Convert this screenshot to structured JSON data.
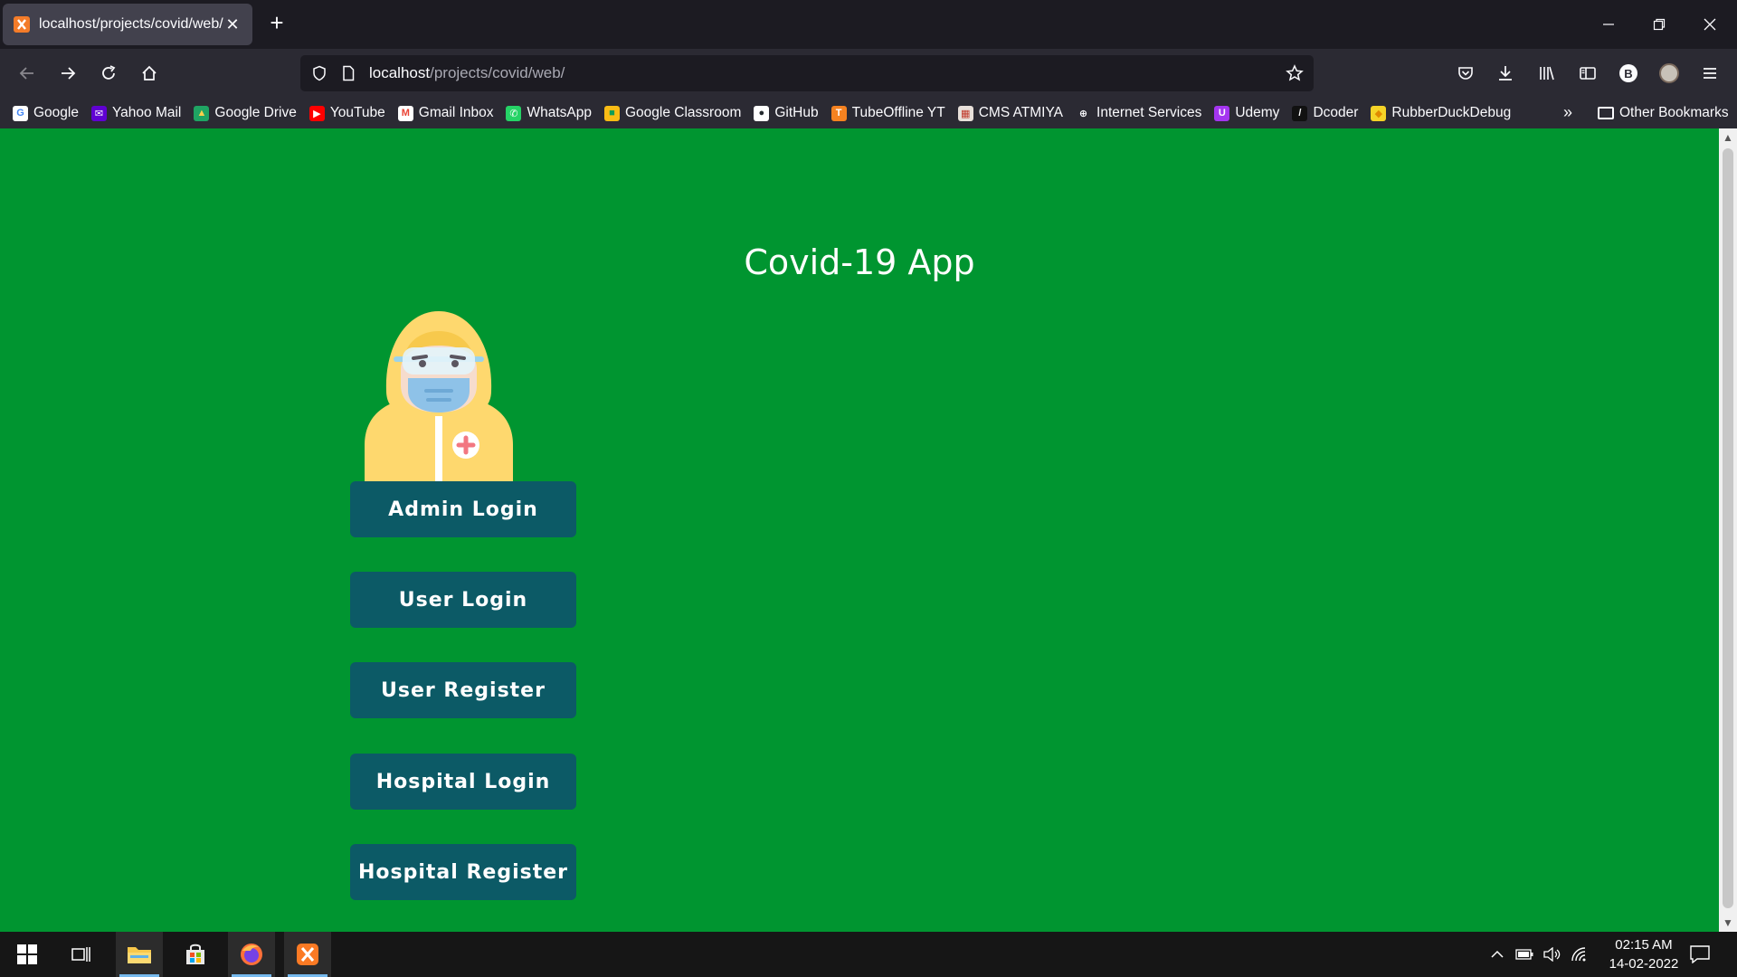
{
  "browser": {
    "tab": {
      "title": "localhost/projects/covid/web/",
      "close_glyph": "✕"
    },
    "new_tab_glyph": "+",
    "url": {
      "host": "localhost",
      "path": "/projects/covid/web/"
    },
    "profile_initial": "B"
  },
  "bookmarks": [
    {
      "label": "Google",
      "icon": "google-icon",
      "color": "#ffffff",
      "glyph": "G",
      "glyph_color": "#4285f4"
    },
    {
      "label": "Yahoo Mail",
      "icon": "yahoo-mail-icon",
      "color": "#6001d2",
      "glyph": "✉",
      "glyph_color": "#ffffff"
    },
    {
      "label": "Google Drive",
      "icon": "google-drive-icon",
      "color": "#1fa463",
      "glyph": "▲",
      "glyph_color": "#ffd04b"
    },
    {
      "label": "YouTube",
      "icon": "youtube-icon",
      "color": "#ff0000",
      "glyph": "▶",
      "glyph_color": "#ffffff"
    },
    {
      "label": "Gmail Inbox",
      "icon": "gmail-icon",
      "color": "#ffffff",
      "glyph": "M",
      "glyph_color": "#ea4335"
    },
    {
      "label": "WhatsApp",
      "icon": "whatsapp-icon",
      "color": "#25d366",
      "glyph": "✆",
      "glyph_color": "#ffffff"
    },
    {
      "label": "Google Classroom",
      "icon": "google-classroom-icon",
      "color": "#f9bc15",
      "glyph": "■",
      "glyph_color": "#0f9d58"
    },
    {
      "label": "GitHub",
      "icon": "github-icon",
      "color": "#ffffff",
      "glyph": "●",
      "glyph_color": "#24292e"
    },
    {
      "label": "TubeOffline YT",
      "icon": "tubeoffline-icon",
      "color": "#f58220",
      "glyph": "T",
      "glyph_color": "#ffffff"
    },
    {
      "label": "CMS ATMIYA",
      "icon": "cms-atmiya-icon",
      "color": "#e8e0da",
      "glyph": "▦",
      "glyph_color": "#c0392b"
    },
    {
      "label": "Internet Services",
      "icon": "globe-icon",
      "color": "#2b2a33",
      "glyph": "⊕",
      "glyph_color": "#fbfbfe"
    },
    {
      "label": "Udemy",
      "icon": "udemy-icon",
      "color": "#a435f0",
      "glyph": "U",
      "glyph_color": "#ffffff"
    },
    {
      "label": "Dcoder",
      "icon": "dcoder-icon",
      "color": "#111111",
      "glyph": "/",
      "glyph_color": "#ffffff"
    },
    {
      "label": "RubberDuckDebug",
      "icon": "rubber-duck-icon",
      "color": "#f5d327",
      "glyph": "◆",
      "glyph_color": "#e08a00"
    }
  ],
  "bookmarks_more_glyph": "»",
  "other_bookmarks": "Other Bookmarks",
  "page": {
    "title": "Covid-19 App",
    "buttons": [
      "Admin Login",
      "User Login",
      "User Register",
      "Hospital Login",
      "Hospital Register"
    ],
    "background": "#009530",
    "button_color": "#0c5a66"
  },
  "taskbar": {
    "time": "02:15 AM",
    "date": "14-02-2022"
  }
}
